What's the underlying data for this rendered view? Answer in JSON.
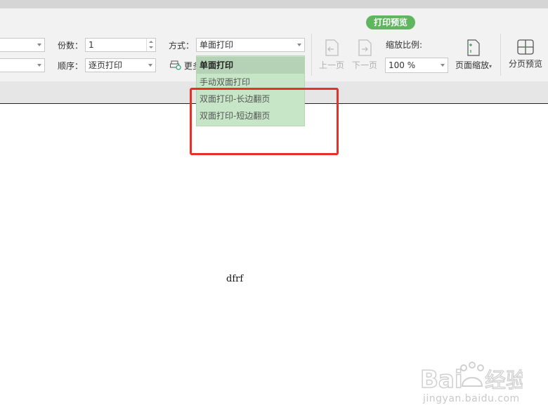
{
  "toolbar": {
    "mode_badge": "打印预览",
    "copies_label": "份数：",
    "copies_value": "1",
    "order_label": "顺序：",
    "order_value": "逐页打印",
    "method_label": "方式：",
    "method_value": "单面打印",
    "more_label": "更多",
    "prev_page": "上一页",
    "next_page": "下一页",
    "zoom_label": "缩放比例:",
    "zoom_value": "100 %",
    "page_zoom": "页面缩放",
    "page_preview": "分页预览"
  },
  "dropdown": {
    "items": [
      {
        "label": "单面打印",
        "selected": true
      },
      {
        "label": "手动双面打印",
        "selected": false
      },
      {
        "label": "双面打印-长边翻页",
        "selected": false
      },
      {
        "label": "双面打印-短边翻页",
        "selected": false
      }
    ]
  },
  "document": {
    "text": "dfrf"
  },
  "watermark": {
    "url": "jingyan.baidu.com"
  },
  "colors": {
    "badge": "#5fb65f",
    "dropdown_bg": "#c7e6c7",
    "highlight_box": "#e8302a"
  }
}
